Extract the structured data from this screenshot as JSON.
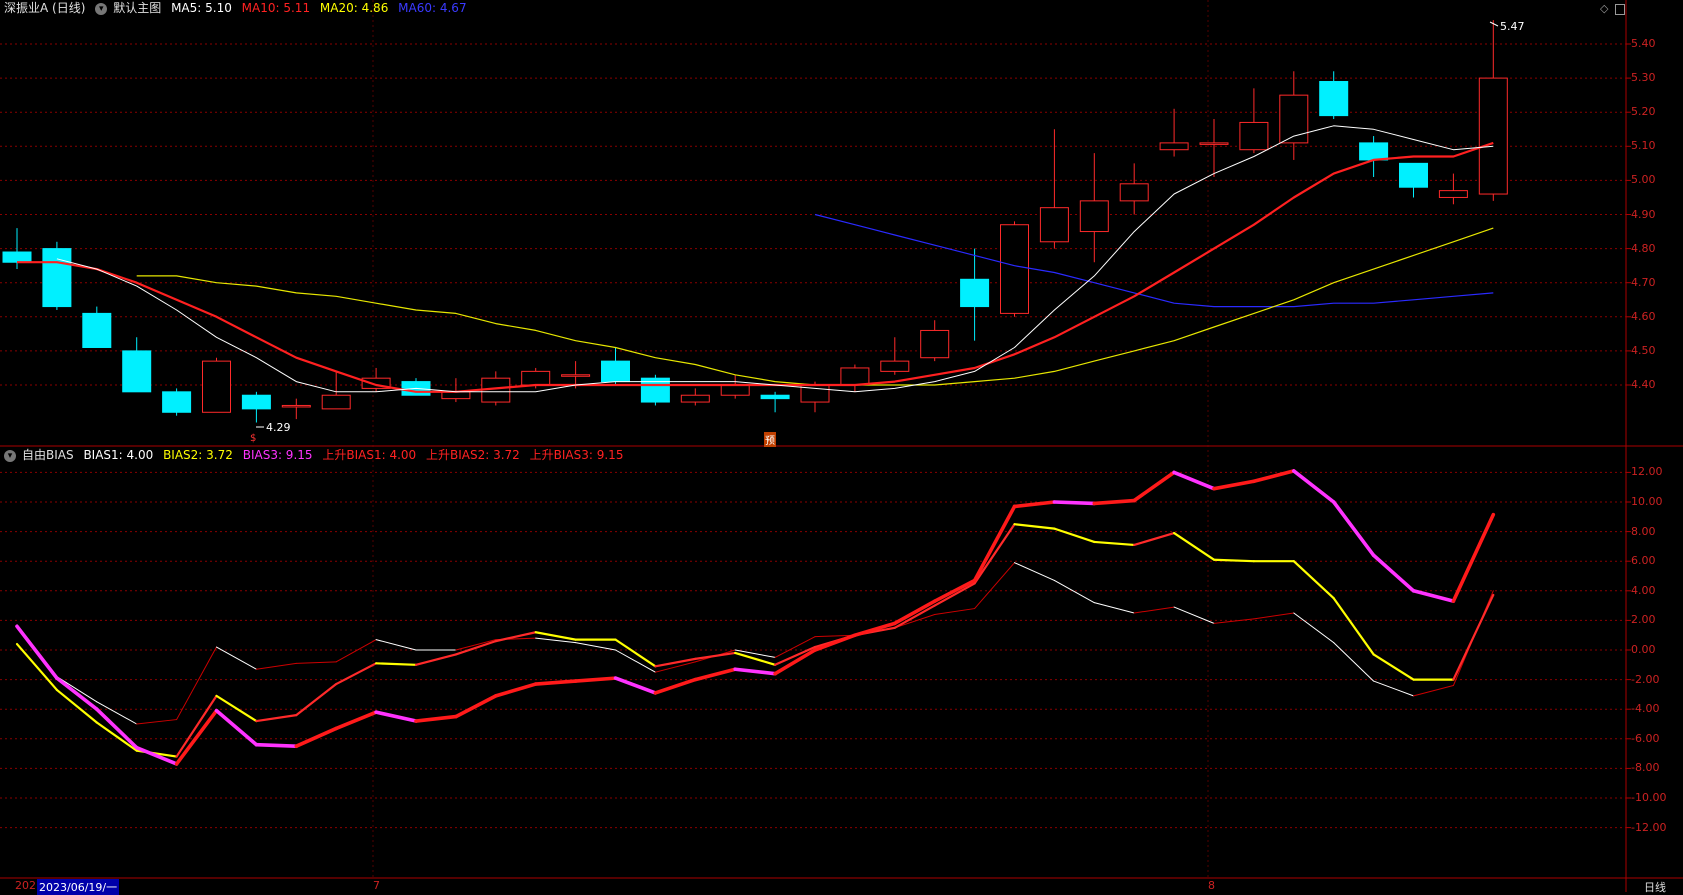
{
  "main": {
    "stock_title": "深振业A (日线)",
    "indicator_name": "默认主图",
    "ma": [
      {
        "label": "MA5: 5.10",
        "color": "#ffffff"
      },
      {
        "label": "MA10: 5.11",
        "color": "#ff2222"
      },
      {
        "label": "MA20: 4.86",
        "color": "#ffff00"
      },
      {
        "label": "MA60: 4.67",
        "color": "#2a2aff"
      }
    ],
    "high_label": "5.47",
    "low_label": "4.29",
    "marker_1": "$",
    "marker_2": "预",
    "price_ticks": [
      "5.40",
      "5.30",
      "5.20",
      "5.10",
      "5.00",
      "4.90",
      "4.80",
      "4.70",
      "4.60",
      "4.50",
      "4.40"
    ],
    "candles": [
      {
        "o": 4.79,
        "c": 4.76,
        "h": 4.86,
        "l": 4.74
      },
      {
        "o": 4.8,
        "c": 4.63,
        "h": 4.82,
        "l": 4.62
      },
      {
        "o": 4.61,
        "c": 4.51,
        "h": 4.63,
        "l": 4.51
      },
      {
        "o": 4.5,
        "c": 4.38,
        "h": 4.54,
        "l": 4.38
      },
      {
        "o": 4.38,
        "c": 4.32,
        "h": 4.39,
        "l": 4.31
      },
      {
        "o": 4.32,
        "c": 4.47,
        "h": 4.48,
        "l": 4.32
      },
      {
        "o": 4.37,
        "c": 4.33,
        "h": 4.38,
        "l": 4.29
      },
      {
        "o": 4.34,
        "c": 4.34,
        "h": 4.36,
        "l": 4.3
      },
      {
        "o": 4.33,
        "c": 4.37,
        "h": 4.44,
        "l": 4.33
      },
      {
        "o": 4.39,
        "c": 4.42,
        "h": 4.45,
        "l": 4.38
      },
      {
        "o": 4.41,
        "c": 4.37,
        "h": 4.42,
        "l": 4.37
      },
      {
        "o": 4.36,
        "c": 4.38,
        "h": 4.42,
        "l": 4.35
      },
      {
        "o": 4.35,
        "c": 4.42,
        "h": 4.44,
        "l": 4.34
      },
      {
        "o": 4.4,
        "c": 4.44,
        "h": 4.45,
        "l": 4.39
      },
      {
        "o": 4.43,
        "c": 4.43,
        "h": 4.47,
        "l": 4.39
      },
      {
        "o": 4.47,
        "c": 4.41,
        "h": 4.51,
        "l": 4.4
      },
      {
        "o": 4.42,
        "c": 4.35,
        "h": 4.43,
        "l": 4.34
      },
      {
        "o": 4.35,
        "c": 4.37,
        "h": 4.39,
        "l": 4.34
      },
      {
        "o": 4.37,
        "c": 4.4,
        "h": 4.43,
        "l": 4.36
      },
      {
        "o": 4.37,
        "c": 4.36,
        "h": 4.38,
        "l": 4.32
      },
      {
        "o": 4.35,
        "c": 4.4,
        "h": 4.41,
        "l": 4.32
      },
      {
        "o": 4.4,
        "c": 4.45,
        "h": 4.46,
        "l": 4.38
      },
      {
        "o": 4.44,
        "c": 4.47,
        "h": 4.54,
        "l": 4.43
      },
      {
        "o": 4.48,
        "c": 4.56,
        "h": 4.59,
        "l": 4.47
      },
      {
        "o": 4.71,
        "c": 4.63,
        "h": 4.8,
        "l": 4.53
      },
      {
        "o": 4.61,
        "c": 4.87,
        "h": 4.88,
        "l": 4.6
      },
      {
        "o": 4.82,
        "c": 4.92,
        "h": 5.15,
        "l": 4.8
      },
      {
        "o": 4.85,
        "c": 4.94,
        "h": 5.08,
        "l": 4.76
      },
      {
        "o": 4.94,
        "c": 4.99,
        "h": 5.05,
        "l": 4.9
      },
      {
        "o": 5.09,
        "c": 5.11,
        "h": 5.21,
        "l": 5.07
      },
      {
        "o": 5.11,
        "c": 5.11,
        "h": 5.18,
        "l": 5.01
      },
      {
        "o": 5.09,
        "c": 5.17,
        "h": 5.27,
        "l": 5.08
      },
      {
        "o": 5.11,
        "c": 5.25,
        "h": 5.32,
        "l": 5.06
      },
      {
        "o": 5.29,
        "c": 5.19,
        "h": 5.32,
        "l": 5.18
      },
      {
        "o": 5.11,
        "c": 5.06,
        "h": 5.13,
        "l": 5.01
      },
      {
        "o": 5.05,
        "c": 4.98,
        "h": 5.05,
        "l": 4.95
      },
      {
        "o": 4.95,
        "c": 4.97,
        "h": 5.02,
        "l": 4.93
      },
      {
        "o": 4.96,
        "c": 5.3,
        "h": 5.47,
        "l": 4.94
      }
    ],
    "ma5": [
      4.77,
      4.74,
      4.69,
      4.62,
      4.54,
      4.48,
      4.41,
      4.38,
      4.38,
      4.39,
      4.38,
      4.38,
      4.38,
      4.4,
      4.41,
      4.41,
      4.41,
      4.41,
      4.4,
      4.39,
      4.38,
      4.39,
      4.41,
      4.44,
      4.51,
      4.62,
      4.72,
      4.85,
      4.96,
      5.02,
      5.07,
      5.13,
      5.16,
      5.15,
      5.12,
      5.09,
      5.1
    ],
    "ma10": [
      4.76,
      4.76,
      4.74,
      4.7,
      4.65,
      4.6,
      4.54,
      4.48,
      4.44,
      4.4,
      4.38,
      4.38,
      4.39,
      4.4,
      4.4,
      4.4,
      4.4,
      4.4,
      4.4,
      4.4,
      4.4,
      4.4,
      4.41,
      4.43,
      4.45,
      4.49,
      4.54,
      4.6,
      4.66,
      4.73,
      4.8,
      4.87,
      4.95,
      5.02,
      5.06,
      5.07,
      5.07,
      5.11
    ],
    "ma20": [
      4.72,
      4.72,
      4.7,
      4.69,
      4.67,
      4.66,
      4.64,
      4.62,
      4.61,
      4.58,
      4.56,
      4.53,
      4.51,
      4.48,
      4.46,
      4.43,
      4.41,
      4.4,
      4.4,
      4.4,
      4.4,
      4.41,
      4.42,
      4.44,
      4.47,
      4.5,
      4.53,
      4.57,
      4.61,
      4.65,
      4.7,
      4.74,
      4.78,
      4.82,
      4.86
    ],
    "ma60": [
      4.9,
      4.87,
      4.84,
      4.81,
      4.78,
      4.75,
      4.73,
      4.7,
      4.67,
      4.64,
      4.63,
      4.63,
      4.63,
      4.64,
      4.64,
      4.65,
      4.66,
      4.67
    ]
  },
  "bias": {
    "title": "自由BIAS",
    "labels": [
      {
        "text": "BIAS1: 4.00",
        "color": "#ffffff"
      },
      {
        "text": "BIAS2: 3.72",
        "color": "#ffff00"
      },
      {
        "text": "BIAS3: 9.15",
        "color": "#ff33ff"
      },
      {
        "text": "上升BIAS1: 4.00",
        "color": "#ff2222"
      },
      {
        "text": "上升BIAS2: 3.72",
        "color": "#ff2222"
      },
      {
        "text": "上升BIAS3: 9.15",
        "color": "#ff2222"
      }
    ],
    "ticks": [
      "12.00",
      "10.00",
      "8.00",
      "6.00",
      "4.00",
      "2.00",
      "0.00",
      "-2.00",
      "-4.00",
      "-6.00",
      "-8.00",
      "-10.00",
      "-12.00"
    ],
    "bias1": [
      1.7,
      -1.8,
      -3.5,
      -5.0,
      -4.7,
      0.2,
      -1.3,
      -0.9,
      -0.8,
      0.7,
      0.0,
      0.0,
      0.7,
      0.8,
      0.5,
      0.0,
      -1.5,
      -0.8,
      0.0,
      -0.5,
      0.9,
      1.0,
      1.5,
      2.4,
      2.8,
      5.9,
      4.7,
      3.2,
      2.5,
      2.9,
      1.8,
      2.1,
      2.5,
      0.5,
      -2.1,
      -3.1,
      -2.4,
      4.0
    ],
    "bias2": [
      0.4,
      -2.7,
      -4.9,
      -6.8,
      -7.2,
      -3.1,
      -4.8,
      -4.4,
      -2.3,
      -0.9,
      -1.0,
      -0.3,
      0.6,
      1.2,
      0.7,
      0.7,
      -1.1,
      -0.6,
      -0.2,
      -1.0,
      0.2,
      1.0,
      1.5,
      3.0,
      4.5,
      8.5,
      8.2,
      7.3,
      7.1,
      7.9,
      6.1,
      6.0,
      6.0,
      3.5,
      -0.3,
      -2.0,
      -2.0,
      3.72
    ],
    "bias3": [
      1.6,
      -1.9,
      -4.0,
      -6.6,
      -7.7,
      -4.1,
      -6.4,
      -6.5,
      -5.3,
      -4.2,
      -4.8,
      -4.5,
      -3.1,
      -2.3,
      -2.1,
      -1.9,
      -2.9,
      -2.0,
      -1.3,
      -1.6,
      0.0,
      1.0,
      1.8,
      3.3,
      4.7,
      9.7,
      10.0,
      9.9,
      10.1,
      12.0,
      10.9,
      11.4,
      12.1,
      10.0,
      6.4,
      4.0,
      3.3,
      9.15
    ]
  },
  "xaxis": {
    "label_a": "202",
    "date_label": "2023/06/19/一",
    "month_7": "7",
    "month_8": "8",
    "period_label": "日线"
  },
  "colors": {
    "up": "#ff2a2a",
    "down": "#00f0ff",
    "grid": "#8a0000",
    "axis": "#aa0000"
  }
}
